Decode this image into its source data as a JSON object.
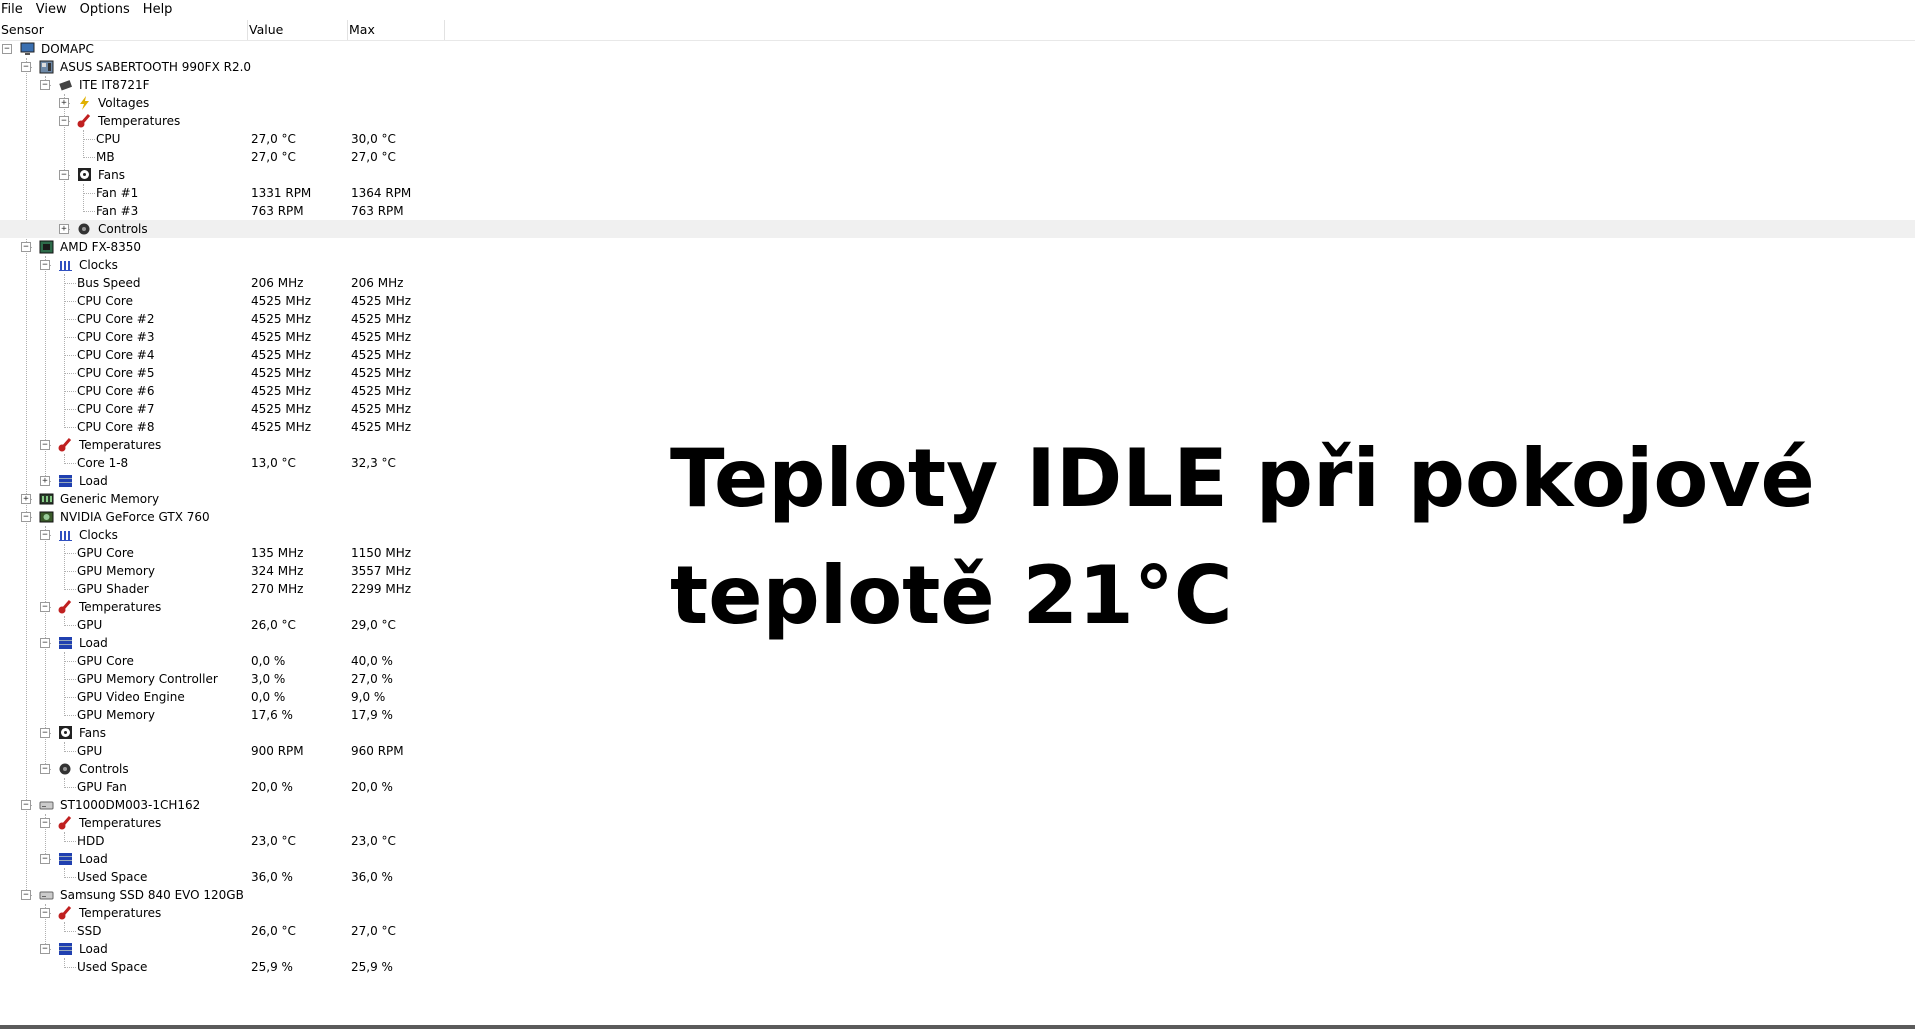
{
  "menu": [
    "File",
    "View",
    "Options",
    "Help"
  ],
  "columns": {
    "sensor": "Sensor",
    "value": "Value",
    "max": "Max"
  },
  "rows": [
    {
      "level": 0,
      "exp": "-",
      "icon": "computer-icon",
      "name": "DOMAPC",
      "value": "",
      "max": ""
    },
    {
      "level": 1,
      "exp": "-",
      "icon": "motherboard-icon",
      "name": "ASUS SABERTOOTH 990FX R2.0",
      "value": "",
      "max": ""
    },
    {
      "level": 2,
      "exp": "-",
      "icon": "chip-icon",
      "name": "ITE IT8721F",
      "value": "",
      "max": ""
    },
    {
      "level": 3,
      "exp": "+",
      "icon": "voltage-icon",
      "name": "Voltages",
      "value": "",
      "max": ""
    },
    {
      "level": 3,
      "exp": "-",
      "icon": "thermometer-icon",
      "name": "Temperatures",
      "value": "",
      "max": ""
    },
    {
      "level": 4,
      "exp": "",
      "icon": "",
      "name": "CPU",
      "value": "27,0 °C",
      "max": "30,0 °C"
    },
    {
      "level": 4,
      "exp": "",
      "icon": "",
      "name": "MB",
      "value": "27,0 °C",
      "max": "27,0 °C"
    },
    {
      "level": 3,
      "exp": "-",
      "icon": "fan-icon",
      "name": "Fans",
      "value": "",
      "max": ""
    },
    {
      "level": 4,
      "exp": "",
      "icon": "",
      "name": "Fan #1",
      "value": "1331 RPM",
      "max": "1364 RPM"
    },
    {
      "level": 4,
      "exp": "",
      "icon": "",
      "name": "Fan #3",
      "value": "763 RPM",
      "max": "763 RPM"
    },
    {
      "level": 3,
      "exp": "+",
      "icon": "control-icon",
      "name": "Controls",
      "value": "",
      "max": "",
      "selected": true
    },
    {
      "level": 1,
      "exp": "-",
      "icon": "cpu-icon",
      "name": "AMD FX-8350",
      "value": "",
      "max": ""
    },
    {
      "level": 2,
      "exp": "-",
      "icon": "clock-icon",
      "name": "Clocks",
      "value": "",
      "max": ""
    },
    {
      "level": 3,
      "exp": "",
      "icon": "",
      "name": "Bus Speed",
      "value": "206 MHz",
      "max": "206 MHz"
    },
    {
      "level": 3,
      "exp": "",
      "icon": "",
      "name": "CPU Core",
      "value": "4525 MHz",
      "max": "4525 MHz"
    },
    {
      "level": 3,
      "exp": "",
      "icon": "",
      "name": "CPU Core #2",
      "value": "4525 MHz",
      "max": "4525 MHz"
    },
    {
      "level": 3,
      "exp": "",
      "icon": "",
      "name": "CPU Core #3",
      "value": "4525 MHz",
      "max": "4525 MHz"
    },
    {
      "level": 3,
      "exp": "",
      "icon": "",
      "name": "CPU Core #4",
      "value": "4525 MHz",
      "max": "4525 MHz"
    },
    {
      "level": 3,
      "exp": "",
      "icon": "",
      "name": "CPU Core #5",
      "value": "4525 MHz",
      "max": "4525 MHz"
    },
    {
      "level": 3,
      "exp": "",
      "icon": "",
      "name": "CPU Core #6",
      "value": "4525 MHz",
      "max": "4525 MHz"
    },
    {
      "level": 3,
      "exp": "",
      "icon": "",
      "name": "CPU Core #7",
      "value": "4525 MHz",
      "max": "4525 MHz"
    },
    {
      "level": 3,
      "exp": "",
      "icon": "",
      "name": "CPU Core #8",
      "value": "4525 MHz",
      "max": "4525 MHz"
    },
    {
      "level": 2,
      "exp": "-",
      "icon": "thermometer-icon",
      "name": "Temperatures",
      "value": "",
      "max": ""
    },
    {
      "level": 3,
      "exp": "",
      "icon": "",
      "name": "Core 1-8",
      "value": "13,0 °C",
      "max": "32,3 °C"
    },
    {
      "level": 2,
      "exp": "+",
      "icon": "load-icon",
      "name": "Load",
      "value": "",
      "max": ""
    },
    {
      "level": 1,
      "exp": "+",
      "icon": "memory-icon",
      "name": "Generic Memory",
      "value": "",
      "max": ""
    },
    {
      "level": 1,
      "exp": "-",
      "icon": "gpu-icon",
      "name": "NVIDIA GeForce GTX 760",
      "value": "",
      "max": ""
    },
    {
      "level": 2,
      "exp": "-",
      "icon": "clock-icon",
      "name": "Clocks",
      "value": "",
      "max": ""
    },
    {
      "level": 3,
      "exp": "",
      "icon": "",
      "name": "GPU Core",
      "value": "135 MHz",
      "max": "1150 MHz"
    },
    {
      "level": 3,
      "exp": "",
      "icon": "",
      "name": "GPU Memory",
      "value": "324 MHz",
      "max": "3557 MHz"
    },
    {
      "level": 3,
      "exp": "",
      "icon": "",
      "name": "GPU Shader",
      "value": "270 MHz",
      "max": "2299 MHz"
    },
    {
      "level": 2,
      "exp": "-",
      "icon": "thermometer-icon",
      "name": "Temperatures",
      "value": "",
      "max": ""
    },
    {
      "level": 3,
      "exp": "",
      "icon": "",
      "name": "GPU",
      "value": "26,0 °C",
      "max": "29,0 °C"
    },
    {
      "level": 2,
      "exp": "-",
      "icon": "load-icon",
      "name": "Load",
      "value": "",
      "max": ""
    },
    {
      "level": 3,
      "exp": "",
      "icon": "",
      "name": "GPU Core",
      "value": "0,0 %",
      "max": "40,0 %"
    },
    {
      "level": 3,
      "exp": "",
      "icon": "",
      "name": "GPU Memory Controller",
      "value": "3,0 %",
      "max": "27,0 %"
    },
    {
      "level": 3,
      "exp": "",
      "icon": "",
      "name": "GPU Video Engine",
      "value": "0,0 %",
      "max": "9,0 %"
    },
    {
      "level": 3,
      "exp": "",
      "icon": "",
      "name": "GPU Memory",
      "value": "17,6 %",
      "max": "17,9 %"
    },
    {
      "level": 2,
      "exp": "-",
      "icon": "fan-icon",
      "name": "Fans",
      "value": "",
      "max": ""
    },
    {
      "level": 3,
      "exp": "",
      "icon": "",
      "name": "GPU",
      "value": "900 RPM",
      "max": "960 RPM"
    },
    {
      "level": 2,
      "exp": "-",
      "icon": "control-icon",
      "name": "Controls",
      "value": "",
      "max": ""
    },
    {
      "level": 3,
      "exp": "",
      "icon": "",
      "name": "GPU Fan",
      "value": "20,0 %",
      "max": "20,0 %"
    },
    {
      "level": 1,
      "exp": "-",
      "icon": "hdd-icon",
      "name": "ST1000DM003-1CH162",
      "value": "",
      "max": ""
    },
    {
      "level": 2,
      "exp": "-",
      "icon": "thermometer-icon",
      "name": "Temperatures",
      "value": "",
      "max": ""
    },
    {
      "level": 3,
      "exp": "",
      "icon": "",
      "name": "HDD",
      "value": "23,0 °C",
      "max": "23,0 °C"
    },
    {
      "level": 2,
      "exp": "-",
      "icon": "load-icon",
      "name": "Load",
      "value": "",
      "max": ""
    },
    {
      "level": 3,
      "exp": "",
      "icon": "",
      "name": "Used Space",
      "value": "36,0 %",
      "max": "36,0 %"
    },
    {
      "level": 1,
      "exp": "-",
      "icon": "hdd-icon",
      "name": "Samsung SSD 840 EVO 120GB",
      "value": "",
      "max": ""
    },
    {
      "level": 2,
      "exp": "-",
      "icon": "thermometer-icon",
      "name": "Temperatures",
      "value": "",
      "max": ""
    },
    {
      "level": 3,
      "exp": "",
      "icon": "",
      "name": "SSD",
      "value": "26,0 °C",
      "max": "27,0 °C"
    },
    {
      "level": 2,
      "exp": "-",
      "icon": "load-icon",
      "name": "Load",
      "value": "",
      "max": ""
    },
    {
      "level": 3,
      "exp": "",
      "icon": "",
      "name": "Used Space",
      "value": "25,9 %",
      "max": "25,9 %"
    }
  ],
  "overlay": {
    "line1": "Teploty IDLE při pokojové",
    "line2": "teplotě 21°C"
  }
}
